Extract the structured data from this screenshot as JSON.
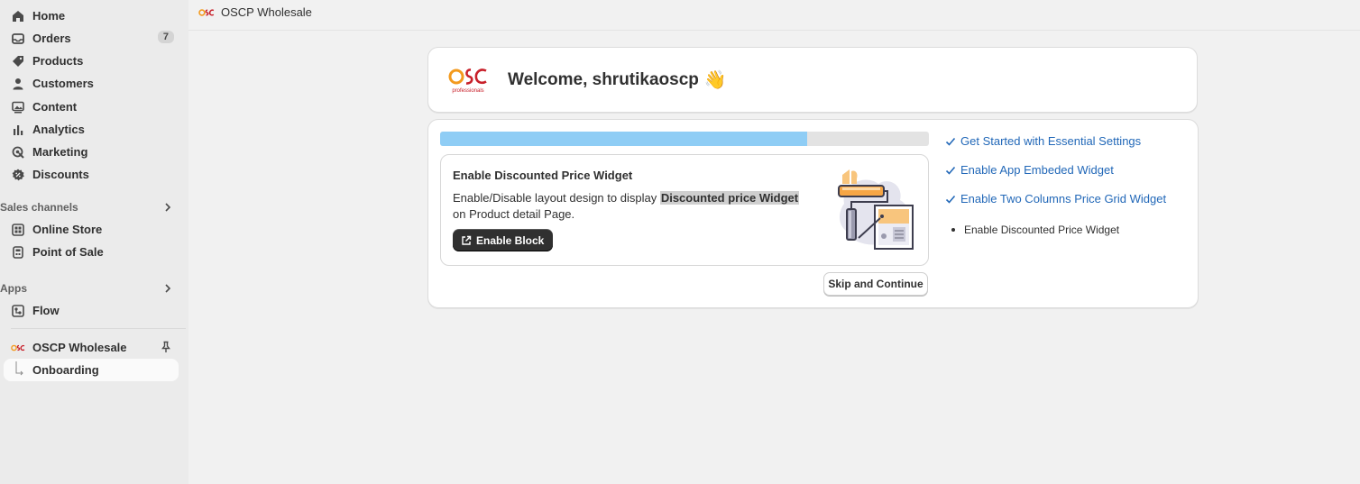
{
  "sidebar": {
    "items": [
      {
        "label": "Home",
        "icon": "home-icon"
      },
      {
        "label": "Orders",
        "icon": "inbox-icon",
        "badge": "7"
      },
      {
        "label": "Products",
        "icon": "tag-icon"
      },
      {
        "label": "Customers",
        "icon": "person-icon"
      },
      {
        "label": "Content",
        "icon": "image-icon"
      },
      {
        "label": "Analytics",
        "icon": "bar-chart-icon"
      },
      {
        "label": "Marketing",
        "icon": "target-icon"
      },
      {
        "label": "Discounts",
        "icon": "discount-icon"
      }
    ],
    "sales_channels": {
      "heading": "Sales channels",
      "items": [
        {
          "label": "Online Store",
          "icon": "store-icon"
        },
        {
          "label": "Point of Sale",
          "icon": "pos-icon"
        }
      ]
    },
    "apps": {
      "heading": "Apps",
      "items": [
        {
          "label": "Flow",
          "icon": "flow-icon"
        }
      ]
    },
    "pinned_app": {
      "label": "OSCP Wholesale",
      "icon": "osc-logo-icon",
      "sub_item": "Onboarding"
    }
  },
  "topbar": {
    "app_title": "OSCP Wholesale"
  },
  "welcome": {
    "text": "Welcome, shrutikaoscp",
    "emoji": "👋",
    "logo_text": "OSC",
    "logo_sub": "professionals"
  },
  "onboarding": {
    "progress": 0.75,
    "step": {
      "title": "Enable Discounted Price Widget",
      "desc_before": "Enable/Disable layout design to display ",
      "desc_highlight": "Discounted price Widget",
      "desc_after": " on Product detail Page.",
      "button_label": "Enable Block"
    },
    "skip_label": "Skip and Continue",
    "checklist": [
      {
        "label": "Get Started with Essential Settings",
        "done": true
      },
      {
        "label": "Enable App Embeded Widget",
        "done": true
      },
      {
        "label": "Enable Two Columns Price Grid Widget",
        "done": true
      }
    ],
    "current_step": "Enable Discounted Price Widget"
  },
  "colors": {
    "accent_link": "#2268b8",
    "progress_fill": "#8fcdf5",
    "primary_button": "#303030",
    "logo_orange": "#f39a1e",
    "logo_red": "#c8202a"
  }
}
